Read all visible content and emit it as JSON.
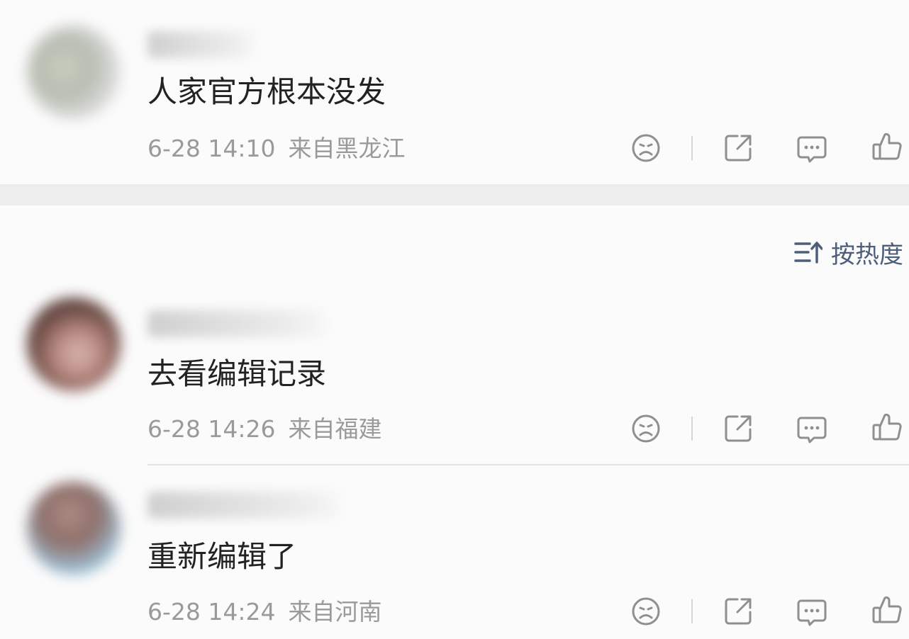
{
  "comments": [
    {
      "text": "人家官方根本没发",
      "time": "6-28 14:10",
      "location": "来自黑龙江"
    },
    {
      "text": "去看编辑记录",
      "time": "6-28 14:26",
      "location": "来自福建"
    },
    {
      "text": "重新编辑了",
      "time": "6-28 14:24",
      "location": "来自河南"
    }
  ],
  "sort": {
    "label": "按热度",
    "icon": "sort-icon"
  },
  "actions": {
    "icons": [
      "sad-face-icon",
      "share-icon",
      "comment-icon",
      "like-icon"
    ]
  },
  "colors": {
    "meta_text": "#9a9a9a",
    "sort_text": "#4d5e7c",
    "section_gap": "#ededed"
  }
}
